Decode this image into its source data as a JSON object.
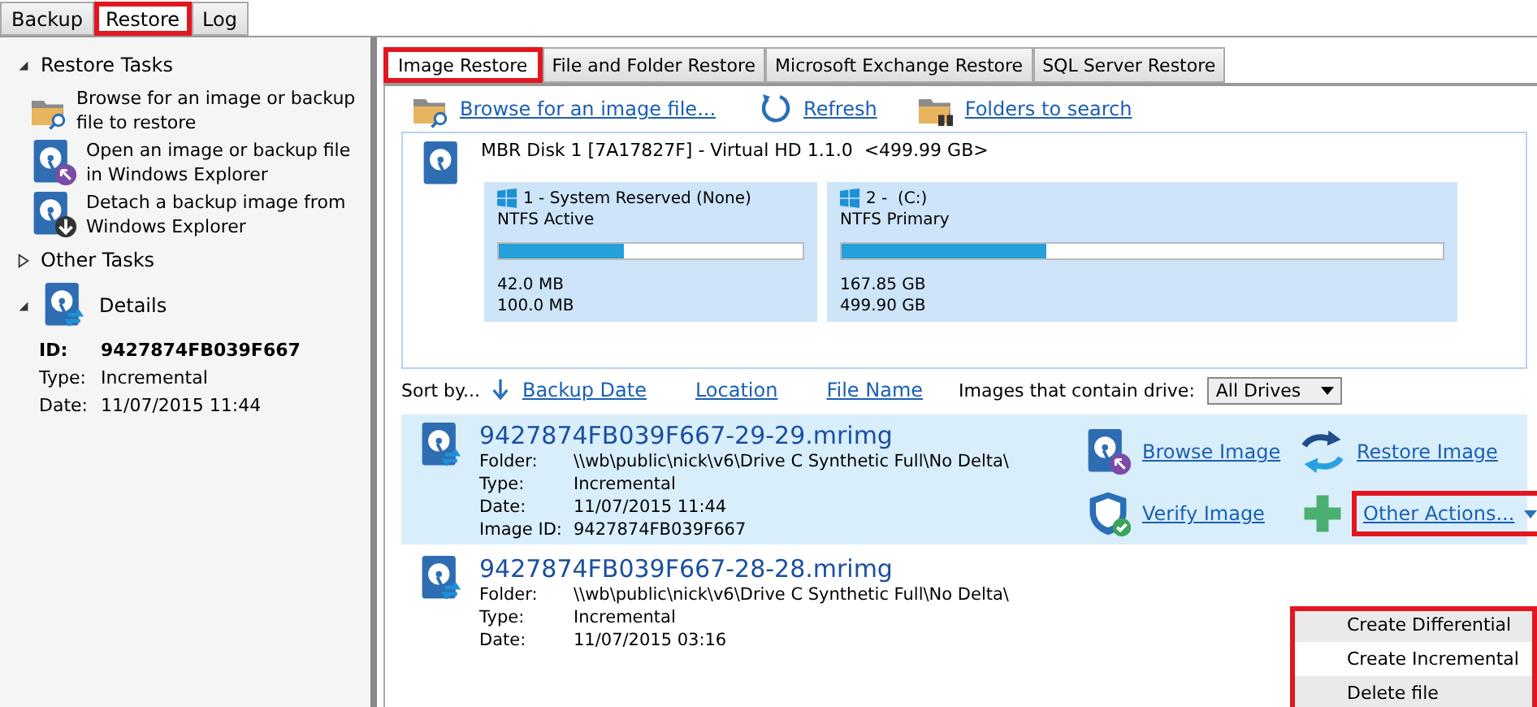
{
  "main_tabs": [
    {
      "label": "Backup",
      "selected": false,
      "highlighted": false
    },
    {
      "label": "Restore",
      "selected": true,
      "highlighted": true
    },
    {
      "label": "Log",
      "selected": false,
      "highlighted": false
    }
  ],
  "sidebar": {
    "sections": [
      {
        "title": "Restore Tasks",
        "expanded": true,
        "items": [
          {
            "label": "Browse for an image or backup file to restore"
          },
          {
            "label": "Open an image or backup file in Windows Explorer"
          },
          {
            "label": "Detach a backup image from Windows Explorer"
          }
        ]
      },
      {
        "title": "Other Tasks",
        "expanded": false
      },
      {
        "title": "Details",
        "expanded": true
      }
    ],
    "details": [
      {
        "label": "ID:",
        "value": "9427874FB039F667"
      },
      {
        "label": "Type:",
        "value": "Incremental"
      },
      {
        "label": "Date:",
        "value": "11/07/2015 11:44"
      }
    ]
  },
  "restore_tabs": [
    {
      "label": "Image Restore",
      "selected": true,
      "highlighted": true
    },
    {
      "label": "File and Folder Restore",
      "selected": false,
      "highlighted": false
    },
    {
      "label": "Microsoft Exchange Restore",
      "selected": false,
      "highlighted": false
    },
    {
      "label": "SQL Server Restore",
      "selected": false,
      "highlighted": false
    }
  ],
  "toolbar": [
    {
      "label": "Browse for an image file..."
    },
    {
      "label": "Refresh"
    },
    {
      "label": "Folders to search"
    }
  ],
  "disk": {
    "title": "MBR Disk 1 [7A17827F] - Virtual HD 1.1.0  <499.99 GB>",
    "partitions": [
      {
        "name": "1 - System Reserved (None)",
        "type": "NTFS Active",
        "level": 0.41,
        "used": "42.0 MB",
        "total": "100.0 MB"
      },
      {
        "name": "2 -  (C:)",
        "type": "NTFS Primary",
        "level": 0.34,
        "used": "167.85 GB",
        "total": "499.90 GB"
      }
    ]
  },
  "sort": {
    "label": "Sort by...",
    "options": [
      "Backup Date",
      "Location",
      "File Name"
    ],
    "filter_label": "Images that contain drive:",
    "filter_value": "All Drives"
  },
  "images": [
    {
      "name": "9427874FB039F667-29-29.mrimg",
      "selected": true,
      "fields": [
        {
          "label": "Folder:",
          "value": "\\\\wb\\public\\nick\\v6\\Drive C Synthetic Full\\No Delta\\"
        },
        {
          "label": "Type:",
          "value": "Incremental"
        },
        {
          "label": "Date:",
          "value": "11/07/2015 11:44"
        },
        {
          "label": "Image ID:",
          "value": "9427874FB039F667"
        }
      ]
    },
    {
      "name": "9427874FB039F667-28-28.mrimg",
      "selected": false,
      "fields": [
        {
          "label": "Folder:",
          "value": "\\\\wb\\public\\nick\\v6\\Drive C Synthetic Full\\No Delta\\"
        },
        {
          "label": "Type:",
          "value": "Incremental"
        },
        {
          "label": "Date:",
          "value": "11/07/2015 03:16"
        }
      ]
    }
  ],
  "actions": [
    {
      "label": "Browse Image",
      "highlighted": false
    },
    {
      "label": "Restore Image",
      "highlighted": false
    },
    {
      "label": "Verify Image",
      "highlighted": false
    },
    {
      "label": "Other Actions...",
      "highlighted": true
    }
  ],
  "context_menu": {
    "highlighted": true,
    "items": [
      {
        "label": "Create Differential",
        "selected": false
      },
      {
        "label": "Create Incremental",
        "selected": true
      },
      {
        "label": "Delete file",
        "selected": false
      }
    ]
  }
}
